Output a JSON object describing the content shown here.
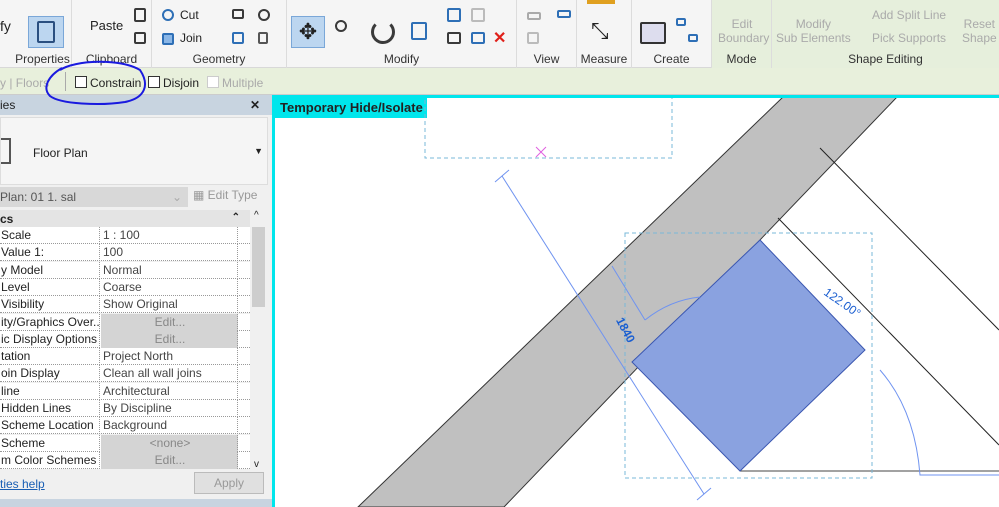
{
  "ribbon": {
    "panels": [
      {
        "label": "Properties"
      },
      {
        "label": "Clipboard"
      },
      {
        "label": "Geometry"
      },
      {
        "label": "Modify"
      },
      {
        "label": "View"
      },
      {
        "label": "Measure"
      },
      {
        "label": "Create"
      },
      {
        "label": "Mode"
      },
      {
        "label": "Shape Editing"
      }
    ],
    "partial_left": "fy",
    "paste": "Paste",
    "cut": "Cut",
    "join": "Join",
    "edit_boundary": [
      "Edit",
      "Boundary"
    ],
    "modify_sub": [
      "Modify",
      "Sub Elements"
    ],
    "add_split_line": "Add Split Line",
    "pick_supports": "Pick Supports",
    "reset_shape": [
      "Reset",
      "Shape"
    ]
  },
  "options_bar": {
    "context": "y | Floors",
    "constrain": "Constrain",
    "disjoin": "Disjoin",
    "multiple": "Multiple"
  },
  "properties": {
    "title": "ies",
    "type_name": "Floor Plan",
    "instance": "Plan: 01 1. sal",
    "edit_type": "Edit Type",
    "section": "cs",
    "rows": [
      {
        "k": "Scale",
        "v": "1 : 100"
      },
      {
        "k": "Value    1:",
        "v": "100"
      },
      {
        "k": "y Model",
        "v": "Normal"
      },
      {
        "k": " Level",
        "v": "Coarse"
      },
      {
        "k": "Visibility",
        "v": "Show Original"
      },
      {
        "k": "ity/Graphics Over...",
        "v": "Edit...",
        "btn": true
      },
      {
        "k": "ic Display Options",
        "v": "Edit...",
        "btn": true
      },
      {
        "k": "tation",
        "v": "Project North"
      },
      {
        "k": "oin Display",
        "v": "Clean all wall joins"
      },
      {
        "k": "line",
        "v": "Architectural"
      },
      {
        "k": " Hidden Lines",
        "v": "By Discipline"
      },
      {
        "k": " Scheme Location",
        "v": "Background"
      },
      {
        "k": " Scheme",
        "v": "<none>",
        "btn": true
      },
      {
        "k": "m Color Schemes",
        "v": "Edit...",
        "btn": true
      }
    ],
    "help": "ties help",
    "apply": "Apply"
  },
  "view": {
    "banner": "Temporary Hide/Isolate",
    "dimension": "1840",
    "angle": "122.00°",
    "colors": {
      "border": "#00e6ec",
      "wall": "#c0c0c0",
      "floor": "#8aa2e0",
      "dim": "#6f93f0",
      "annotation": "#1b5fd1",
      "circle": "#1a1adf"
    }
  }
}
